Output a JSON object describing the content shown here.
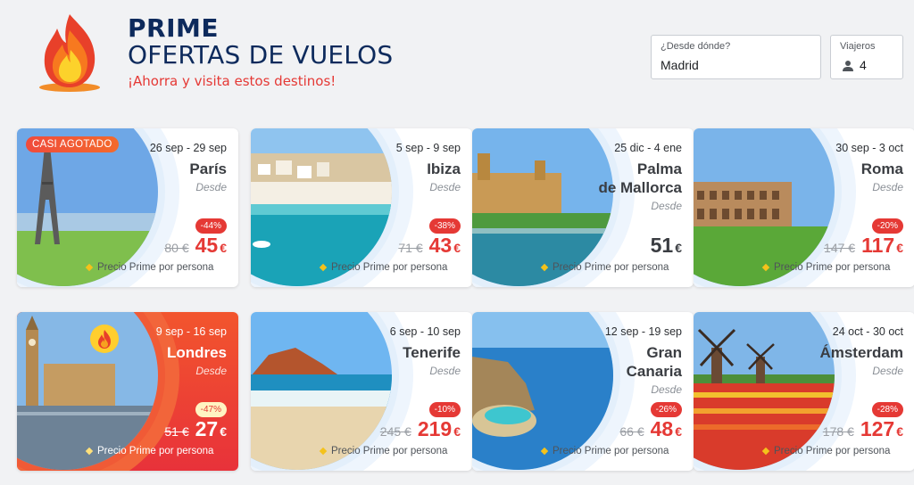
{
  "header": {
    "title": "PRIME",
    "subtitle": "OFERTAS DE VUELOS",
    "slogan": "¡Ahorra y visita estos destinos!"
  },
  "search": {
    "from_label": "¿Desde dónde?",
    "from_value": "Madrid",
    "travelers_label": "Viajeros",
    "travelers_value": "4"
  },
  "cards": [
    {
      "badge": "CASI AGOTADO",
      "dates": "26 sep - 29 sep",
      "city": "París",
      "desde": "Desde",
      "discount": "-44%",
      "old_price": "80 €",
      "price": "45",
      "currency": "€",
      "footer": "Precio Prime por persona"
    },
    {
      "dates": "5 sep - 9 sep",
      "city": "Ibiza",
      "desde": "Desde",
      "discount": "-38%",
      "old_price": "71 €",
      "price": "43",
      "currency": "€",
      "footer": "Precio Prime por persona"
    },
    {
      "dates": "25 dic - 4 ene",
      "city_line1": "Palma",
      "city_line2": "de Mallorca",
      "desde": "Desde",
      "price": "51",
      "currency": "€",
      "footer": "Precio Prime por persona"
    },
    {
      "dates": "30 sep - 3 oct",
      "city": "Roma",
      "desde": "Desde",
      "discount": "-20%",
      "old_price": "147 €",
      "price": "117",
      "currency": "€",
      "footer": "Precio Prime por persona"
    },
    {
      "dates": "9 sep - 16 sep",
      "city": "Londres",
      "desde": "Desde",
      "discount": "-47%",
      "old_price": "51 €",
      "price": "27",
      "currency": "€",
      "footer": "Precio Prime por persona"
    },
    {
      "dates": "6 sep - 10 sep",
      "city": "Tenerife",
      "desde": "Desde",
      "discount": "-10%",
      "old_price": "245 €",
      "price": "219",
      "currency": "€",
      "footer": "Precio Prime por persona"
    },
    {
      "dates": "12 sep - 19 sep",
      "city_line1": "Gran",
      "city_line2": "Canaria",
      "desde": "Desde",
      "discount": "-26%",
      "old_price": "66 €",
      "price": "48",
      "currency": "€",
      "footer": "Precio Prime por persona"
    },
    {
      "dates": "24 oct - 30 oct",
      "city": "Ámsterdam",
      "desde": "Desde",
      "discount": "-28%",
      "old_price": "178 €",
      "price": "127",
      "currency": "€",
      "footer": "Precio Prime por persona"
    }
  ],
  "colors": {
    "navy": "#0d2a5c",
    "red": "#e53935",
    "hot_card": "#ee4535",
    "accent_yellow": "#f4c21b"
  },
  "icons": {
    "logo": "fire-logo-icon",
    "travelers": "person-icon",
    "hot": "fire-icon"
  }
}
